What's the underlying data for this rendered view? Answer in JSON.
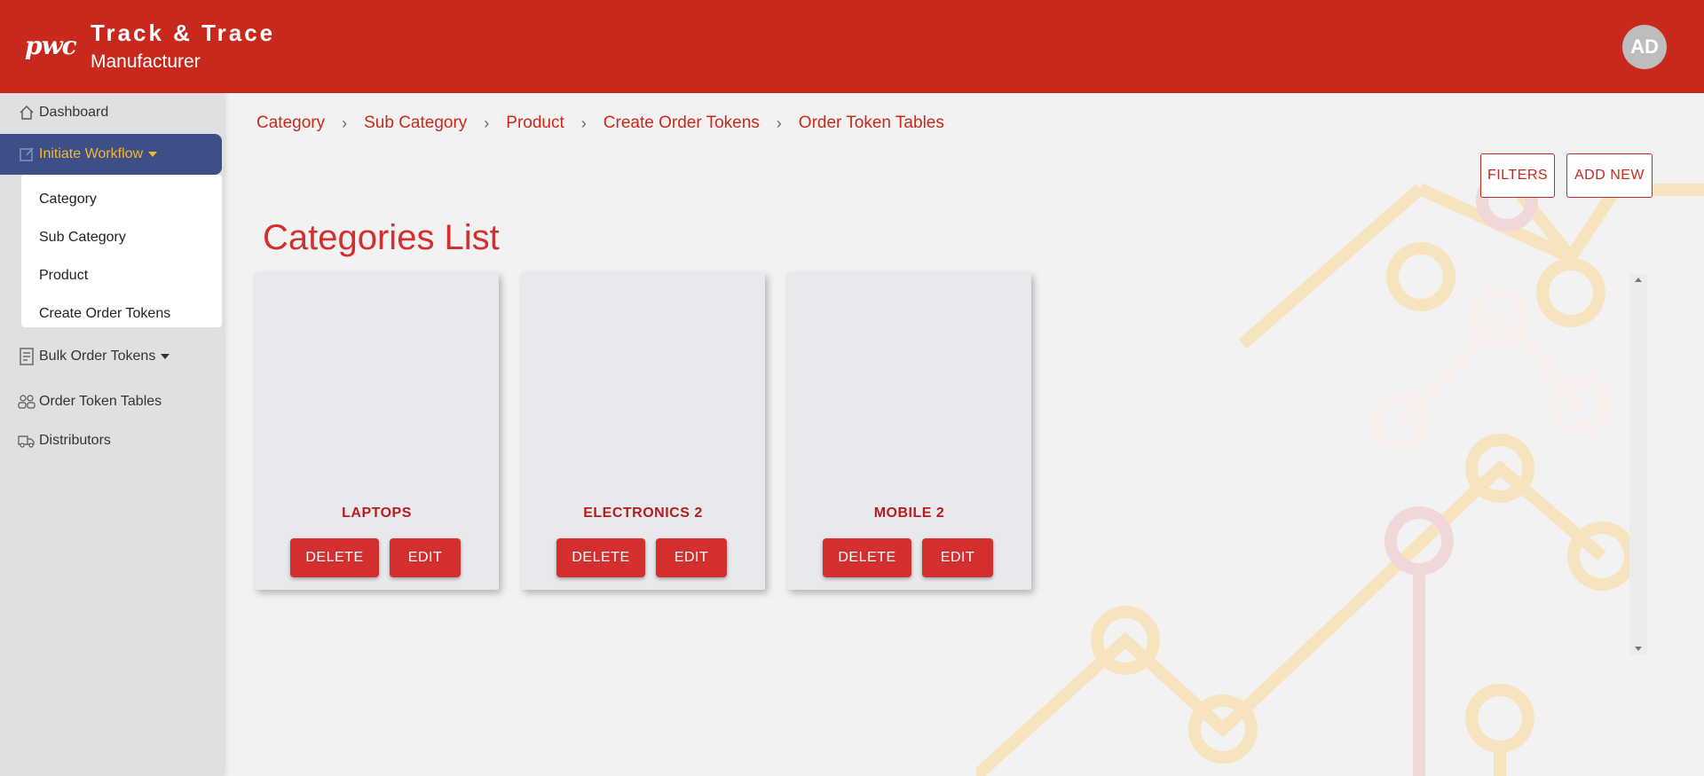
{
  "header": {
    "logo": "pwc",
    "title": "Track & Trace",
    "subtitle": "Manufacturer",
    "avatar_initials": "AD"
  },
  "sidebar": {
    "items": [
      {
        "label": "Dashboard",
        "icon": "home-icon"
      },
      {
        "label": "Initiate Workflow",
        "icon": "edit-icon",
        "active": true,
        "expanded": true
      },
      {
        "label": "Bulk Order Tokens",
        "icon": "document-icon"
      },
      {
        "label": "Order Token Tables",
        "icon": "group-icon"
      },
      {
        "label": "Distributors",
        "icon": "truck-icon"
      }
    ],
    "submenu": [
      "Category",
      "Sub Category",
      "Product",
      "Create Order Tokens"
    ]
  },
  "breadcrumb": [
    "Category",
    "Sub Category",
    "Product",
    "Create Order Tokens",
    "Order Token Tables"
  ],
  "toolbar": {
    "filters_label": "FILTERS",
    "add_new_label": "ADD NEW"
  },
  "page_title": "Categories List",
  "cards": [
    {
      "name": "LAPTOPS",
      "delete_label": "DELETE",
      "edit_label": "EDIT"
    },
    {
      "name": "ELECTRONICS 2",
      "delete_label": "DELETE",
      "edit_label": "EDIT"
    },
    {
      "name": "MOBILE 2",
      "delete_label": "DELETE",
      "edit_label": "EDIT"
    }
  ],
  "colors": {
    "brand_red": "#c8291c",
    "active_nav_bg": "#3d4f86",
    "active_nav_text": "#f5b731",
    "button_red": "#d32f2f"
  }
}
